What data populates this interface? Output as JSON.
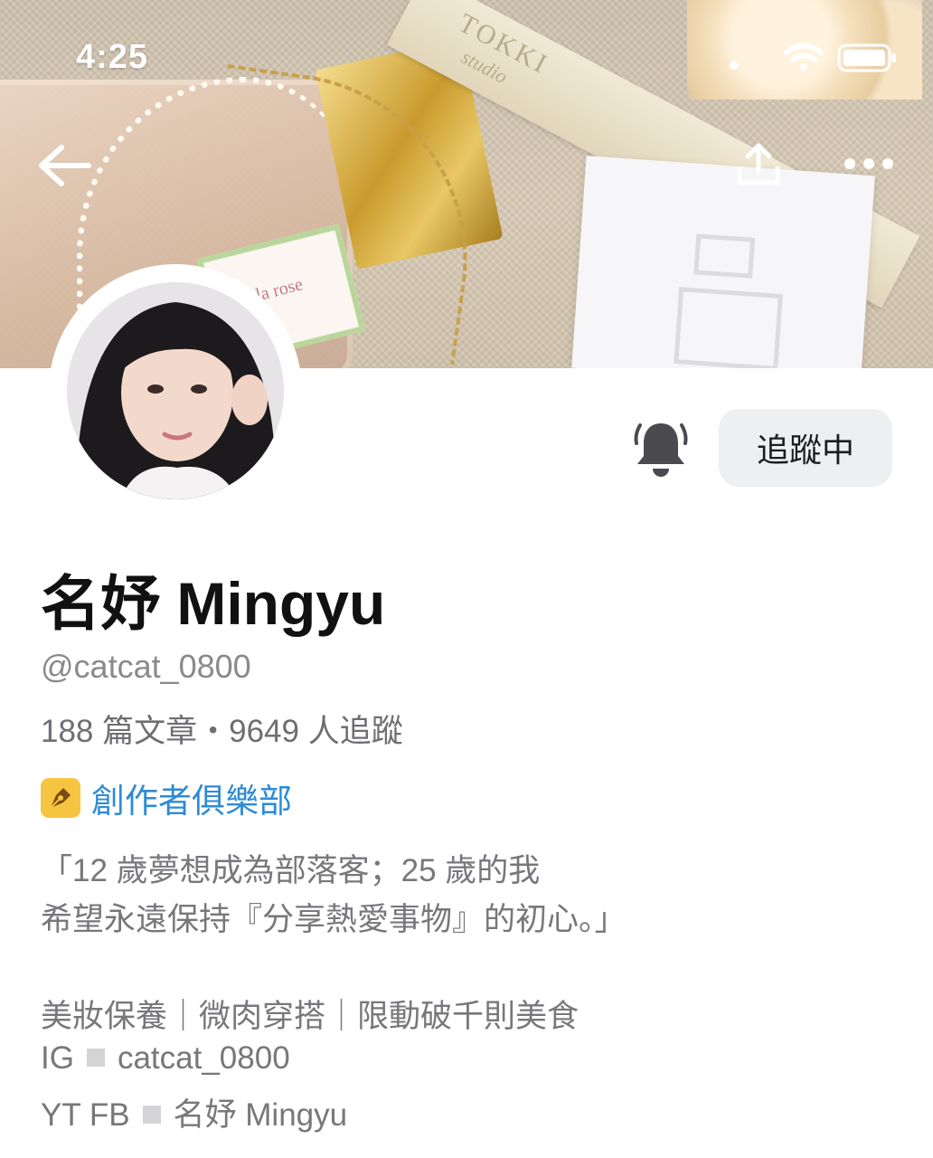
{
  "status_bar": {
    "time": "4:25"
  },
  "cover": {
    "photo_description_icons": [
      "perfume-bottle",
      "gold-cap",
      "pearl-necklace",
      "ribbon",
      "flower",
      "white-card"
    ],
    "ribbon_text": "TOKKI",
    "ribbon_subtext": "studio",
    "bottle_label_text": "la rose"
  },
  "nav": {
    "back_icon": "back-arrow-icon",
    "share_icon": "share-icon",
    "more_icon": "more-icon"
  },
  "profile": {
    "display_name": "名妤 Mingyu",
    "username": "@catcat_0800",
    "stats": "188 篇文章・9649 人追蹤",
    "club_label": "創作者俱樂部",
    "bio": {
      "line1": "「12 歲夢想成為部落客；25 歲的我",
      "line2": "希望永遠保持『分享熱愛事物』的初心。」",
      "line3": "美妝保養｜微肉穿搭｜限動破千則美食",
      "ig_prefix": "IG",
      "ig_handle": "catcat_0800",
      "yt_prefix": "YT FB",
      "yt_name": "名妤 Mingyu"
    }
  },
  "actions": {
    "following_label": "追蹤中",
    "bell_icon": "bell-icon"
  },
  "colors": {
    "club_link": "#2e8bd4",
    "club_icon_bg": "#f5c542",
    "button_bg": "#eeeff1"
  }
}
